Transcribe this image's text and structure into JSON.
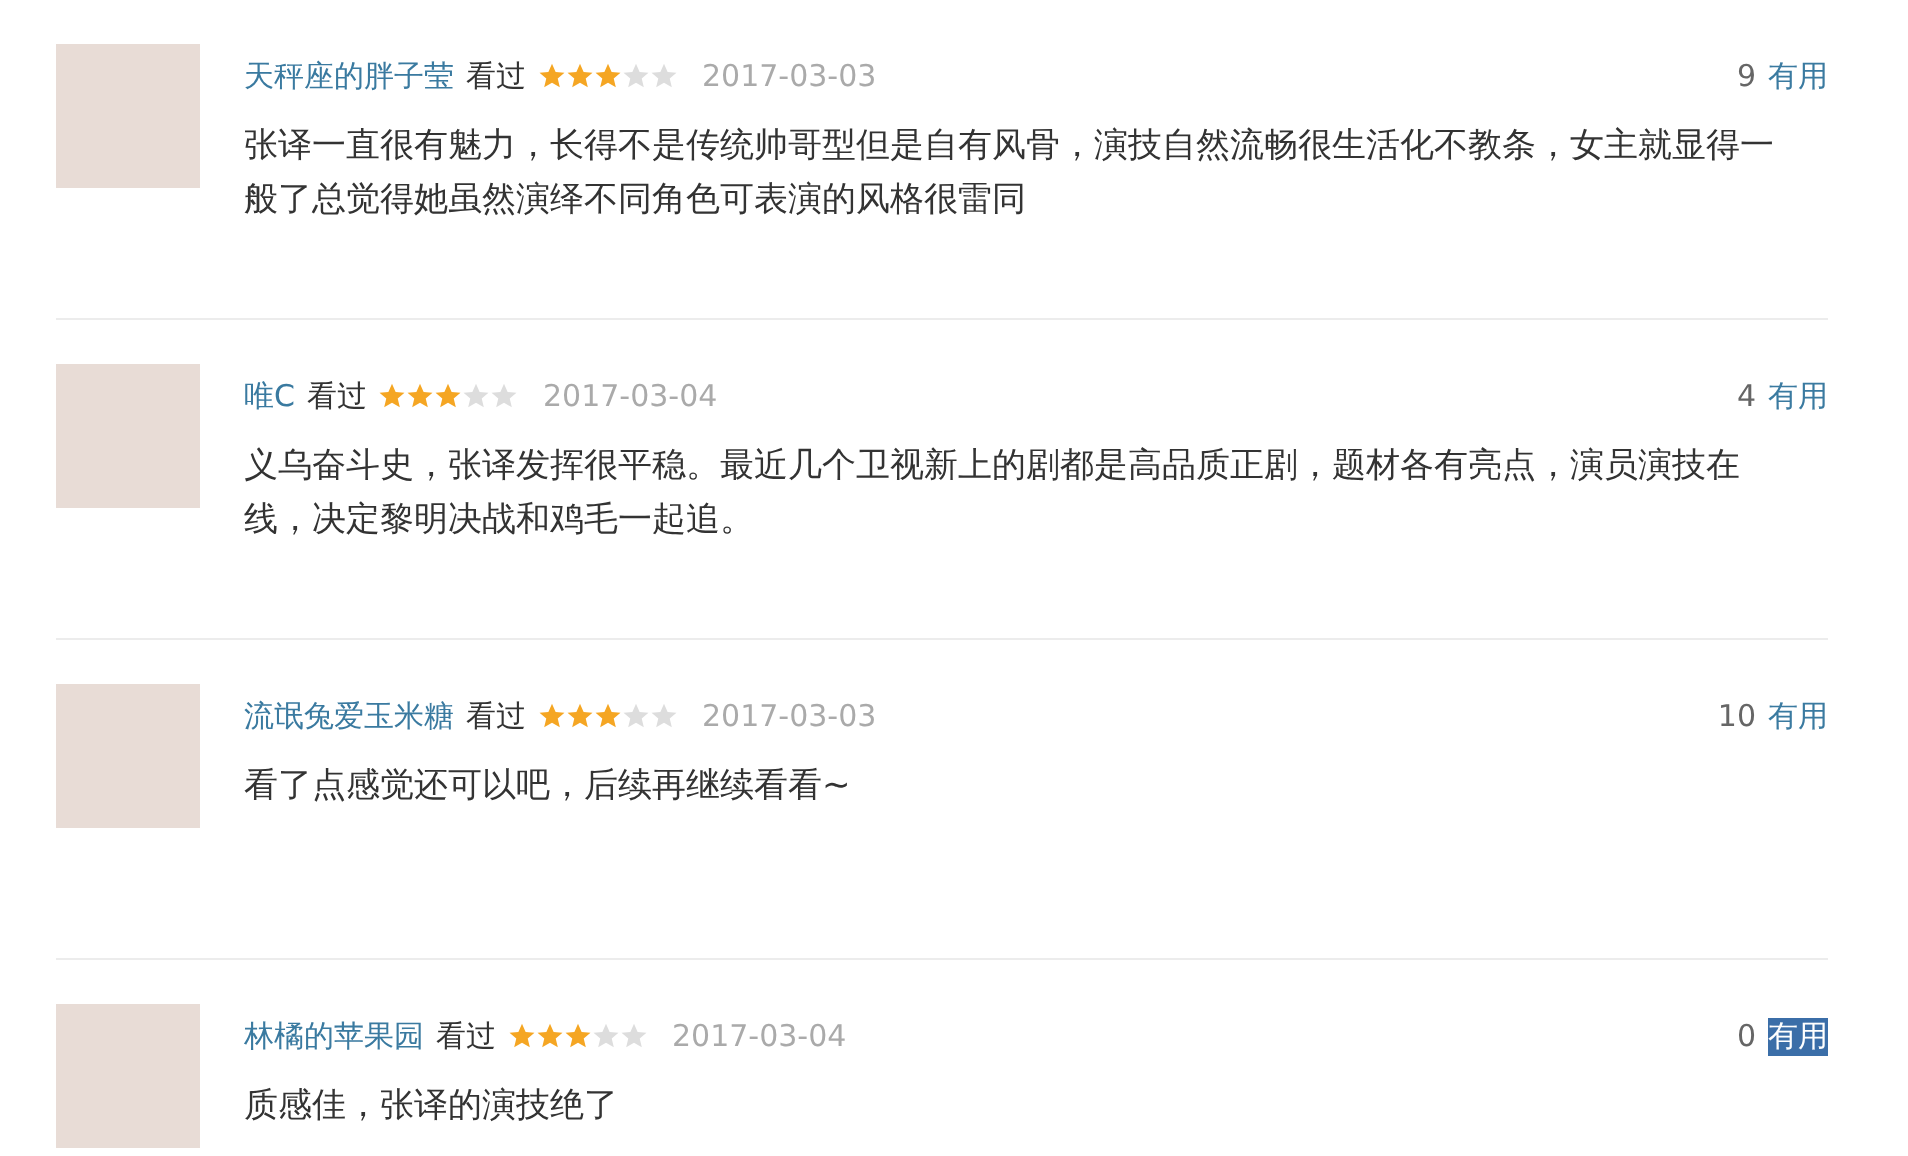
{
  "comments": [
    {
      "user": "天秤座的胖子莹",
      "status": "看过",
      "stars": 3,
      "date": "2017-03-03",
      "votes": "9",
      "useful": "有用",
      "highlighted": false,
      "text": "张译一直很有魅力，长得不是传统帅哥型但是自有风骨，演技自然流畅很生活化不教条，女主就显得一般了总觉得她虽然演绎不同角色可表演的风格很雷同"
    },
    {
      "user": "唯C",
      "status": "看过",
      "stars": 3,
      "date": "2017-03-04",
      "votes": "4",
      "useful": "有用",
      "highlighted": false,
      "text": "义乌奋斗史，张译发挥很平稳。最近几个卫视新上的剧都是高品质正剧，题材各有亮点，演员演技在线，决定黎明决战和鸡毛一起追。"
    },
    {
      "user": "流氓兔爱玉米糖",
      "status": "看过",
      "stars": 3,
      "date": "2017-03-03",
      "votes": "10",
      "useful": "有用",
      "highlighted": false,
      "text": "看了点感觉还可以吧，后续再继续看看~"
    },
    {
      "user": "林橘的苹果园",
      "status": "看过",
      "stars": 3,
      "date": "2017-03-04",
      "votes": "0",
      "useful": "有用",
      "highlighted": true,
      "text": "质感佳，张译的演技绝了"
    }
  ]
}
